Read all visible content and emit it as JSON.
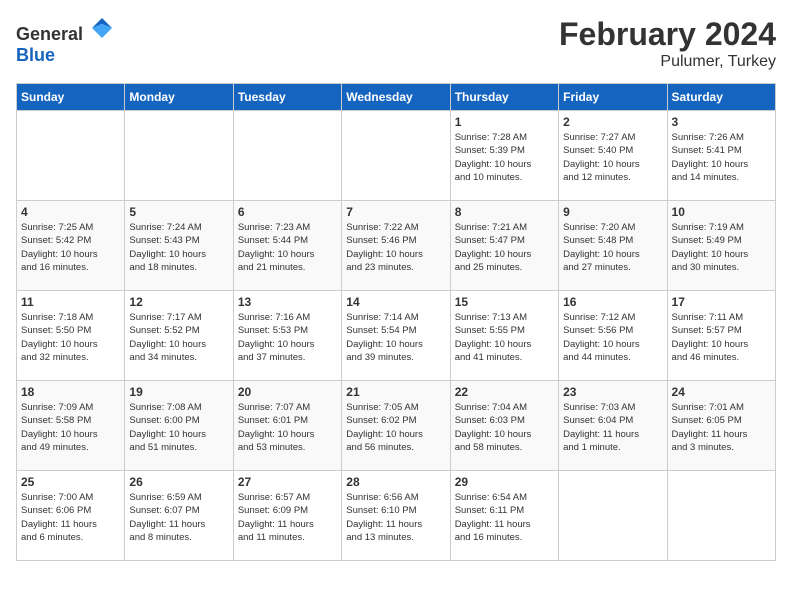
{
  "header": {
    "logo_general": "General",
    "logo_blue": "Blue",
    "title": "February 2024",
    "subtitle": "Pulumer, Turkey"
  },
  "days_of_week": [
    "Sunday",
    "Monday",
    "Tuesday",
    "Wednesday",
    "Thursday",
    "Friday",
    "Saturday"
  ],
  "weeks": [
    [
      {
        "day": "",
        "info": ""
      },
      {
        "day": "",
        "info": ""
      },
      {
        "day": "",
        "info": ""
      },
      {
        "day": "",
        "info": ""
      },
      {
        "day": "1",
        "info": "Sunrise: 7:28 AM\nSunset: 5:39 PM\nDaylight: 10 hours\nand 10 minutes."
      },
      {
        "day": "2",
        "info": "Sunrise: 7:27 AM\nSunset: 5:40 PM\nDaylight: 10 hours\nand 12 minutes."
      },
      {
        "day": "3",
        "info": "Sunrise: 7:26 AM\nSunset: 5:41 PM\nDaylight: 10 hours\nand 14 minutes."
      }
    ],
    [
      {
        "day": "4",
        "info": "Sunrise: 7:25 AM\nSunset: 5:42 PM\nDaylight: 10 hours\nand 16 minutes."
      },
      {
        "day": "5",
        "info": "Sunrise: 7:24 AM\nSunset: 5:43 PM\nDaylight: 10 hours\nand 18 minutes."
      },
      {
        "day": "6",
        "info": "Sunrise: 7:23 AM\nSunset: 5:44 PM\nDaylight: 10 hours\nand 21 minutes."
      },
      {
        "day": "7",
        "info": "Sunrise: 7:22 AM\nSunset: 5:46 PM\nDaylight: 10 hours\nand 23 minutes."
      },
      {
        "day": "8",
        "info": "Sunrise: 7:21 AM\nSunset: 5:47 PM\nDaylight: 10 hours\nand 25 minutes."
      },
      {
        "day": "9",
        "info": "Sunrise: 7:20 AM\nSunset: 5:48 PM\nDaylight: 10 hours\nand 27 minutes."
      },
      {
        "day": "10",
        "info": "Sunrise: 7:19 AM\nSunset: 5:49 PM\nDaylight: 10 hours\nand 30 minutes."
      }
    ],
    [
      {
        "day": "11",
        "info": "Sunrise: 7:18 AM\nSunset: 5:50 PM\nDaylight: 10 hours\nand 32 minutes."
      },
      {
        "day": "12",
        "info": "Sunrise: 7:17 AM\nSunset: 5:52 PM\nDaylight: 10 hours\nand 34 minutes."
      },
      {
        "day": "13",
        "info": "Sunrise: 7:16 AM\nSunset: 5:53 PM\nDaylight: 10 hours\nand 37 minutes."
      },
      {
        "day": "14",
        "info": "Sunrise: 7:14 AM\nSunset: 5:54 PM\nDaylight: 10 hours\nand 39 minutes."
      },
      {
        "day": "15",
        "info": "Sunrise: 7:13 AM\nSunset: 5:55 PM\nDaylight: 10 hours\nand 41 minutes."
      },
      {
        "day": "16",
        "info": "Sunrise: 7:12 AM\nSunset: 5:56 PM\nDaylight: 10 hours\nand 44 minutes."
      },
      {
        "day": "17",
        "info": "Sunrise: 7:11 AM\nSunset: 5:57 PM\nDaylight: 10 hours\nand 46 minutes."
      }
    ],
    [
      {
        "day": "18",
        "info": "Sunrise: 7:09 AM\nSunset: 5:58 PM\nDaylight: 10 hours\nand 49 minutes."
      },
      {
        "day": "19",
        "info": "Sunrise: 7:08 AM\nSunset: 6:00 PM\nDaylight: 10 hours\nand 51 minutes."
      },
      {
        "day": "20",
        "info": "Sunrise: 7:07 AM\nSunset: 6:01 PM\nDaylight: 10 hours\nand 53 minutes."
      },
      {
        "day": "21",
        "info": "Sunrise: 7:05 AM\nSunset: 6:02 PM\nDaylight: 10 hours\nand 56 minutes."
      },
      {
        "day": "22",
        "info": "Sunrise: 7:04 AM\nSunset: 6:03 PM\nDaylight: 10 hours\nand 58 minutes."
      },
      {
        "day": "23",
        "info": "Sunrise: 7:03 AM\nSunset: 6:04 PM\nDaylight: 11 hours\nand 1 minute."
      },
      {
        "day": "24",
        "info": "Sunrise: 7:01 AM\nSunset: 6:05 PM\nDaylight: 11 hours\nand 3 minutes."
      }
    ],
    [
      {
        "day": "25",
        "info": "Sunrise: 7:00 AM\nSunset: 6:06 PM\nDaylight: 11 hours\nand 6 minutes."
      },
      {
        "day": "26",
        "info": "Sunrise: 6:59 AM\nSunset: 6:07 PM\nDaylight: 11 hours\nand 8 minutes."
      },
      {
        "day": "27",
        "info": "Sunrise: 6:57 AM\nSunset: 6:09 PM\nDaylight: 11 hours\nand 11 minutes."
      },
      {
        "day": "28",
        "info": "Sunrise: 6:56 AM\nSunset: 6:10 PM\nDaylight: 11 hours\nand 13 minutes."
      },
      {
        "day": "29",
        "info": "Sunrise: 6:54 AM\nSunset: 6:11 PM\nDaylight: 11 hours\nand 16 minutes."
      },
      {
        "day": "",
        "info": ""
      },
      {
        "day": "",
        "info": ""
      }
    ]
  ]
}
